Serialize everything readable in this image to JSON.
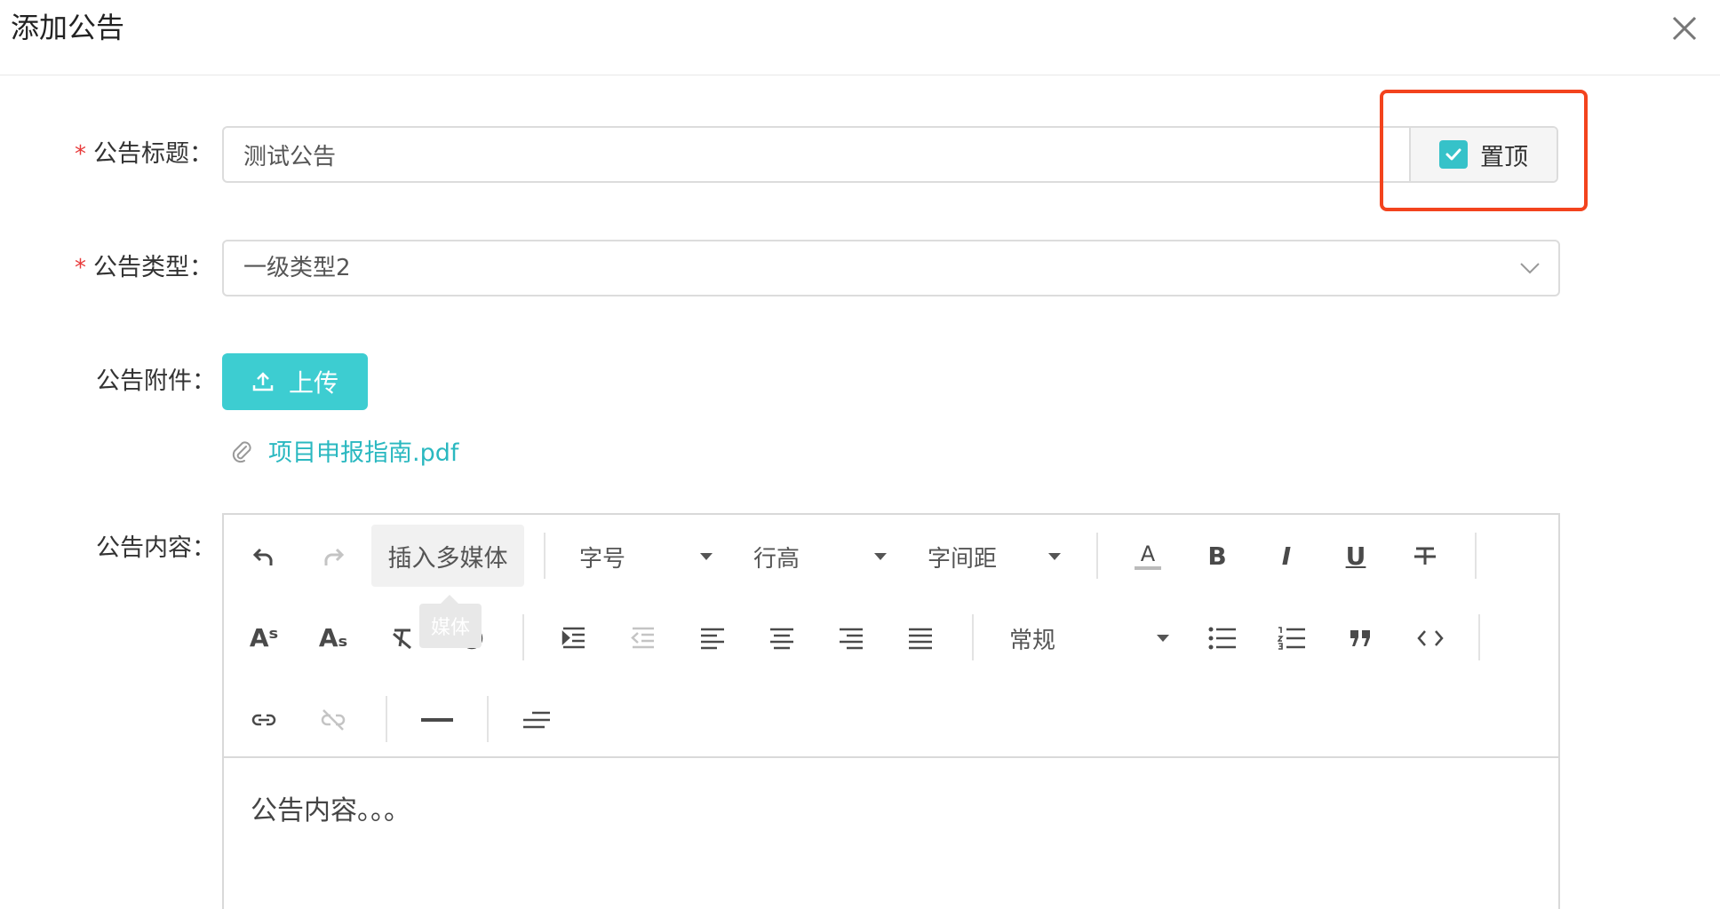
{
  "dialog": {
    "title": "添加公告"
  },
  "form": {
    "title_field": {
      "label": "公告标题：",
      "value": "测试公告",
      "pin_label": "置顶",
      "pin_checked": true
    },
    "type_field": {
      "label": "公告类型：",
      "value": "一级类型2"
    },
    "attachment_field": {
      "label": "公告附件：",
      "upload_label": "上传",
      "files": [
        "项目申报指南.pdf"
      ]
    },
    "content_field": {
      "label": "公告内容：",
      "value": "公告内容。。。"
    }
  },
  "toolbar": {
    "media_label": "插入多媒体",
    "media_tooltip": "媒体",
    "font_size_label": "字号",
    "line_height_label": "行高",
    "letter_spacing_label": "字间距",
    "heading_label": "常规",
    "superscript_glyph": "Aˢ",
    "subscript_glyph": "Aₛ",
    "bold_glyph": "B",
    "italic_glyph": "I",
    "underline_glyph": "U",
    "text_color_glyph": "A"
  },
  "colors": {
    "accent": "#3dcdd1",
    "link": "#2ab8c0",
    "required": "#e83b3b",
    "highlight": "#f3431d"
  }
}
